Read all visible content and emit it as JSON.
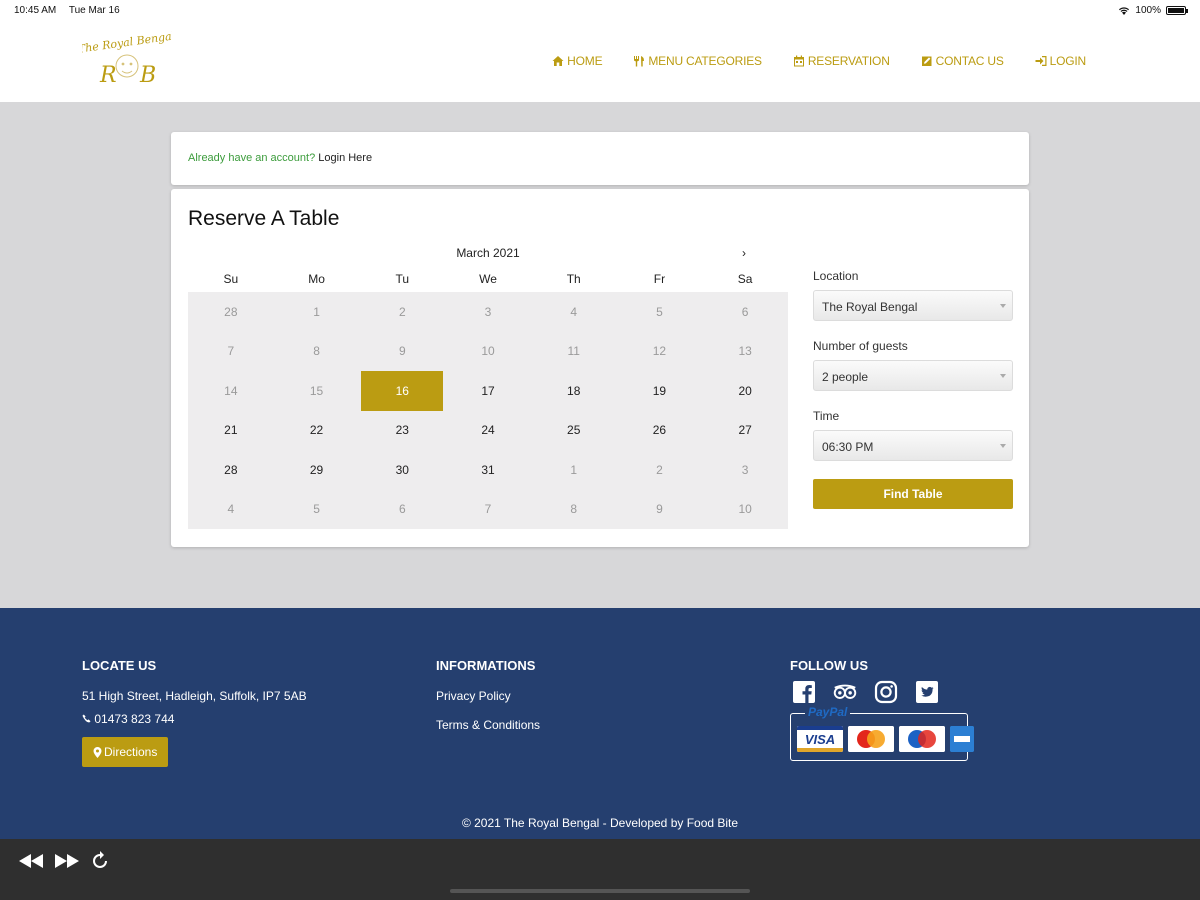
{
  "status": {
    "time": "10:45 AM",
    "date": "Tue Mar 16",
    "battery": "100%"
  },
  "brand": {
    "gold": "#bb9c12",
    "navy": "#253f6f",
    "logo_top": "The Royal Bengal",
    "logo_initial_left": "R",
    "logo_initial_right": "B"
  },
  "nav": [
    {
      "label": "HOME",
      "icon": "home-icon"
    },
    {
      "label": "MENU CATEGORIES",
      "icon": "cutlery-icon"
    },
    {
      "label": "RESERVATION",
      "icon": "calendar-icon"
    },
    {
      "label": "CONTAC US",
      "icon": "edit-icon"
    },
    {
      "label": "LOGIN",
      "icon": "sign-in-icon"
    }
  ],
  "login_prompt": {
    "question": "Already have an account?",
    "link": "Login Here"
  },
  "reserve": {
    "title": "Reserve A Table",
    "month": "March 2021",
    "next": "›",
    "weekdays": [
      "Su",
      "Mo",
      "Tu",
      "We",
      "Th",
      "Fr",
      "Sa"
    ],
    "weeks": [
      [
        "28",
        "1",
        "2",
        "3",
        "4",
        "5",
        "6"
      ],
      [
        "7",
        "8",
        "9",
        "10",
        "11",
        "12",
        "13"
      ],
      [
        "14",
        "15",
        "16",
        "17",
        "18",
        "19",
        "20"
      ],
      [
        "21",
        "22",
        "23",
        "24",
        "25",
        "26",
        "27"
      ],
      [
        "28",
        "29",
        "30",
        "31",
        "1",
        "2",
        "3"
      ],
      [
        "4",
        "5",
        "6",
        "7",
        "8",
        "9",
        "10"
      ]
    ],
    "selected_day": "16",
    "form": {
      "location_label": "Location",
      "location_value": "The Royal Bengal",
      "guests_label": "Number of guests",
      "guests_value": "2 people",
      "time_label": "Time",
      "time_value": "06:30 PM",
      "submit": "Find Table"
    }
  },
  "footer": {
    "locate": {
      "heading": "LOCATE US",
      "address": "51 High Street, Hadleigh, Suffolk, IP7 5AB",
      "phone": "01473 823 744",
      "directions": "Directions"
    },
    "info": {
      "heading": "INFORMATIONS",
      "links": [
        "Privacy Policy",
        "Terms & Conditions"
      ]
    },
    "follow": {
      "heading": "FOLLOW US",
      "social": [
        "facebook-icon",
        "tripadvisor-icon",
        "instagram-icon",
        "twitter-icon"
      ],
      "paypal": "PayPal"
    },
    "copyright": "© 2021 The Royal Bengal - Developed by Food Bite"
  }
}
